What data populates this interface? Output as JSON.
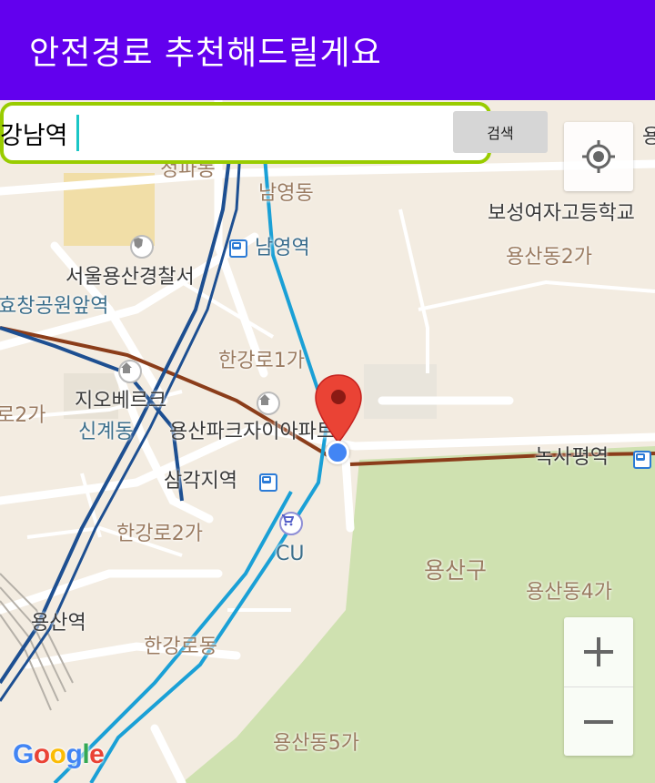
{
  "app_bar": {
    "title": "안전경로 추천해드릴게요"
  },
  "search": {
    "value": "강남역",
    "button_label": "검색"
  },
  "map": {
    "labels": {
      "jeongpadong": "정파동",
      "namyeongdong": "남영동",
      "boseong": "보성여자고등학교",
      "yongsan2ga": "용산동2가",
      "namyeong_station": "남영역",
      "police": "서울용산경찰서",
      "hyochang": "효창공원앞역",
      "hangangro1": "한강로1가",
      "galwolro2": "로2가",
      "jiobereuk": "지오베르크",
      "singye": "신계동",
      "park_xi": "용산파크자이아파트",
      "noksapyeong": "녹사평역",
      "samgakji": "삼각지역",
      "hangangro2": "한강로2가",
      "cu": "CU",
      "yongsangu": "용산구",
      "yongsan4ga": "용산동4가",
      "yongsan_station": "용산역",
      "hangangro": "한강로동",
      "yongsan5ga": "용산동5가",
      "edge_yo": "용"
    },
    "zoom_in": "+",
    "zoom_out": "−",
    "google": [
      "G",
      "o",
      "o",
      "g",
      "l",
      "e"
    ],
    "google_colors": [
      "#4285f4",
      "#ea4335",
      "#fbbc05",
      "#4285f4",
      "#34a853",
      "#ea4335"
    ]
  },
  "icons": {
    "locate": "crosshair-icon",
    "marker": "map-pin-icon",
    "my_location": "current-location-dot"
  },
  "colors": {
    "app_bar": "#6200ee",
    "search_border": "#99cc00",
    "marker": "#ea4335",
    "my_location": "#4285f4"
  }
}
